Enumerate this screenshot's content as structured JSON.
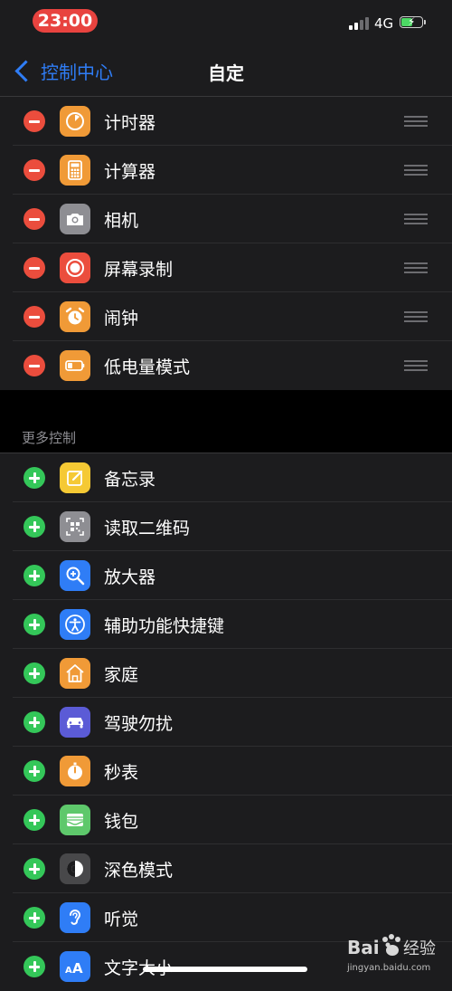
{
  "status_bar": {
    "time": "23:00",
    "network": "4G"
  },
  "nav": {
    "back_label": "控制中心",
    "title": "自定"
  },
  "included": [
    {
      "label": "计时器",
      "icon": "timer-icon",
      "color": "#f09a37"
    },
    {
      "label": "计算器",
      "icon": "calculator-icon",
      "color": "#f09a37"
    },
    {
      "label": "相机",
      "icon": "camera-icon",
      "color": "#8e8e93"
    },
    {
      "label": "屏幕录制",
      "icon": "screen-record-icon",
      "color": "#eb4d3d"
    },
    {
      "label": "闹钟",
      "icon": "alarm-icon",
      "color": "#f09a37"
    },
    {
      "label": "低电量模式",
      "icon": "low-power-icon",
      "color": "#f09a37"
    }
  ],
  "more_header": "更多控制",
  "more": [
    {
      "label": "备忘录",
      "icon": "notes-icon",
      "color": "#f5c934"
    },
    {
      "label": "读取二维码",
      "icon": "qr-code-icon",
      "color": "#8e8e93"
    },
    {
      "label": "放大器",
      "icon": "magnifier-icon",
      "color": "#2f7df6"
    },
    {
      "label": "辅助功能快捷键",
      "icon": "accessibility-icon",
      "color": "#2f7df6"
    },
    {
      "label": "家庭",
      "icon": "home-icon",
      "color": "#f09a37"
    },
    {
      "label": "驾驶勿扰",
      "icon": "car-icon",
      "color": "#5b5bd6"
    },
    {
      "label": "秒表",
      "icon": "stopwatch-icon",
      "color": "#f09a37"
    },
    {
      "label": "钱包",
      "icon": "wallet-icon",
      "color": "#5ec86b"
    },
    {
      "label": "深色模式",
      "icon": "dark-mode-icon",
      "color": "#48484a"
    },
    {
      "label": "听觉",
      "icon": "hearing-icon",
      "color": "#2f7df6"
    },
    {
      "label": "文字大小",
      "icon": "text-size-icon",
      "color": "#2f7df6"
    }
  ],
  "watermark": {
    "brand": "Bai du 经验",
    "url": "jingyan.baidu.com"
  }
}
